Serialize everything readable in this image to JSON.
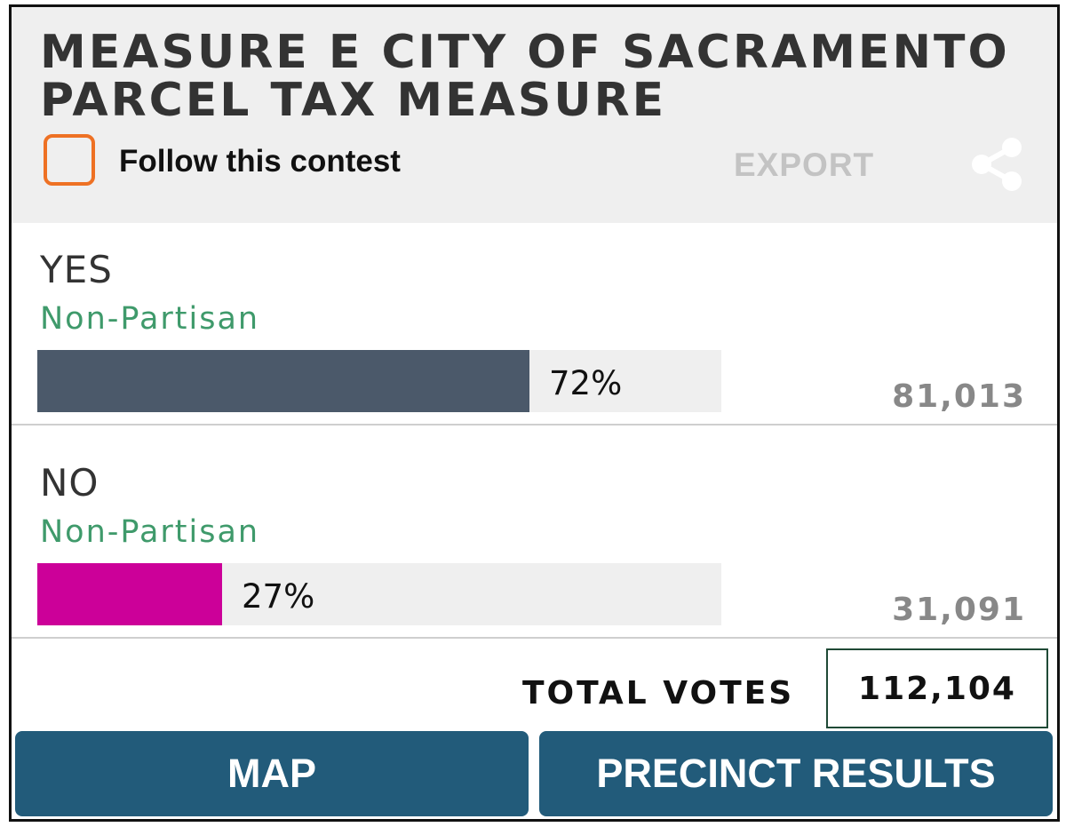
{
  "contest": {
    "title": "MEASURE E CITY OF SACRAMENTO PARCEL TAX MEASURE",
    "follow_label": "Follow this contest",
    "follow_checked": false,
    "export_label": "EXPORT",
    "share_icon": "share-icon"
  },
  "choices": [
    {
      "name": "YES",
      "party": "Non-Partisan",
      "percent": 72,
      "percent_label": "72%",
      "votes": "81,013",
      "bar_color": "#4b596a"
    },
    {
      "name": "NO",
      "party": "Non-Partisan",
      "percent": 27,
      "percent_label": "27%",
      "votes": "31,091",
      "bar_color": "#cc0099"
    }
  ],
  "totals": {
    "label": "TOTAL VOTES",
    "value": "112,104"
  },
  "actions": {
    "map_label": "MAP",
    "precinct_label": "PRECINCT RESULTS"
  },
  "colors": {
    "header_bg": "#efefef",
    "checkbox_border": "#ee7124",
    "party_text": "#3f9a6b",
    "button_bg": "#225b7a",
    "total_box_border": "#1f4a36"
  }
}
